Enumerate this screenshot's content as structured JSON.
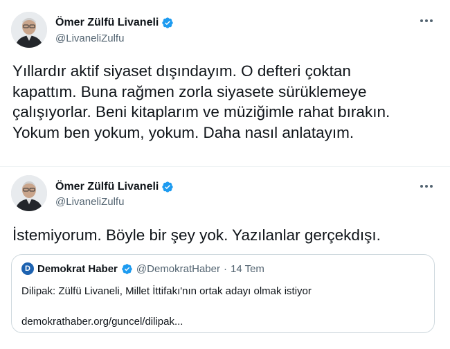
{
  "tweets": [
    {
      "author": {
        "name": "Ömer Zülfü Livaneli",
        "handle": "@LivaneliZulfu",
        "verified": true,
        "avatar_icon": "profile-photo"
      },
      "text": "Yıllardır aktif siyaset dışındayım.  O defteri çoktan\nkapattım.  Buna rağmen zorla siyasete sürüklemeye\nçalışıyorlar.  Beni kitaplarım ve müziğimle rahat bırakın.\nYokum ben yokum, yokum. Daha nasıl anlatayım."
    },
    {
      "author": {
        "name": "Ömer Zülfü Livaneli",
        "handle": "@LivaneliZulfu",
        "verified": true,
        "avatar_icon": "profile-photo"
      },
      "text": "İstemiyorum. Böyle bir şey yok. Yazılanlar gerçekdışı.",
      "quote": {
        "avatar_letter": "D",
        "name": "Demokrat Haber",
        "verified": true,
        "handle": "@DemokratHaber",
        "separator": "·",
        "date": "14 Tem",
        "text": "Dilipak: Zülfü Livaneli, Millet İttifakı'nın ortak adayı olmak istiyor",
        "link": "demokrathaber.org/guncel/dilipak..."
      }
    }
  ],
  "colors": {
    "verified_badge": "#1d9bf0",
    "secondary_text": "#536471",
    "divider": "#eff3f4",
    "quote_border": "#cfd9de"
  },
  "icons": {
    "more": "more-dots-icon",
    "verified": "verified-badge-icon"
  }
}
